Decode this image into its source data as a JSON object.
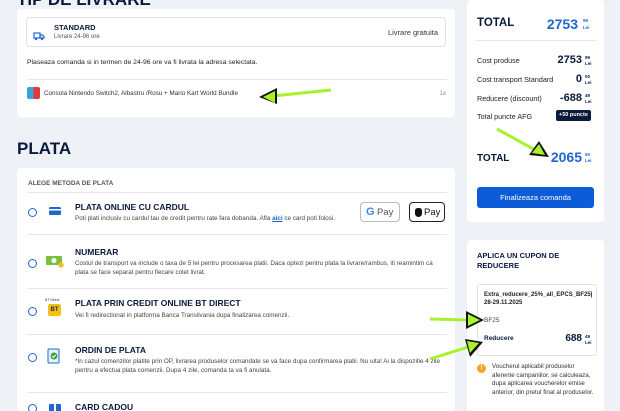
{
  "delivery": {
    "section_title": "TIP DE LIVRARE",
    "method_name": "STANDARD",
    "method_time": "Livrare 24-96 ore",
    "method_price": "Livrare gratuita",
    "info": "Plaseaza comanda si in termen de 24-96 ore va fi livrata la adresa selectata.",
    "product_name": "Consola Nintendo Switch2, Albastru /Rosu + Mario Kart World Bundle",
    "product_qty": "1x"
  },
  "payment": {
    "section_title": "PLATA",
    "subtitle": "ALEGE METODA DE PLATA",
    "options": [
      {
        "title": "PLATA ONLINE CU CARDUL",
        "desc_pre": "Poti plati inclusiv cu cardul tau de credit pentru rate fara dobanda. Afla ",
        "desc_link": "aici",
        "desc_post": " ce card poti folosi."
      },
      {
        "title": "NUMERAR",
        "desc": "Costul de transport va include o taxa de 5 lei pentru procesarea platii. Daca optezi pentru plata la livrare/rambus, iti reamintim ca plata se face separat pentru fiecare colet livrat."
      },
      {
        "title": "PLATA PRIN CREDIT ONLINE BT DIRECT",
        "desc": "Vei fi redirectionat in platforma Banca Transilvania dupa finalizarea comenzii."
      },
      {
        "title": "ORDIN DE PLATA",
        "desc": "*In cazul comenzilor platite prin OP, livrarea produselor comandate se va face dupa confirmarea platii. Nu uita! Ai la dispozitie 4 zile pentru a efectua plata comenzii. Dupa 4 zile, comanda ta va fi anulata."
      },
      {
        "title": "CARD CADOU"
      }
    ],
    "gpay_label": "Pay",
    "applepay_label": "Pay",
    "bt_logo_text": "BT",
    "bt_logo_caption": "BT Direct"
  },
  "summary": {
    "total_label": "TOTAL",
    "total_int": "2753",
    "total_dec": "99",
    "currency": "Lei",
    "rows": [
      {
        "label": "Cost produse",
        "int": "2753",
        "dec": "99"
      },
      {
        "label": "Cost transport Standard",
        "int": "0",
        "dec": "00"
      },
      {
        "label": "Reducere (discount)",
        "int": "-688",
        "dec": "49"
      }
    ],
    "points_label": "Total puncte AFG",
    "points_badge": "+50 puncte",
    "final_label": "TOTAL",
    "final_int": "2065",
    "final_dec": "50",
    "finalize_button": "Finalizeaza comanda"
  },
  "coupon": {
    "title": "APLICA UN CUPON DE REDUCERE",
    "code": "Extra_reducere_25%_all_EPCS_BF25|28-29.11.2025",
    "code_short": "BF25",
    "discount_label": "Reducere",
    "discount_int": "688",
    "discount_dec": "49",
    "notice": "Voucherul aplicabil produselor aferente campaniilor, se calculeaza, dupa aplicarea voucherelor emise anterior, din pretul final al produselor."
  },
  "colors": {
    "accent": "#1f66d1",
    "button": "#0d5bd7",
    "arrow": "#a8f22b",
    "background": "#eef1f5"
  }
}
